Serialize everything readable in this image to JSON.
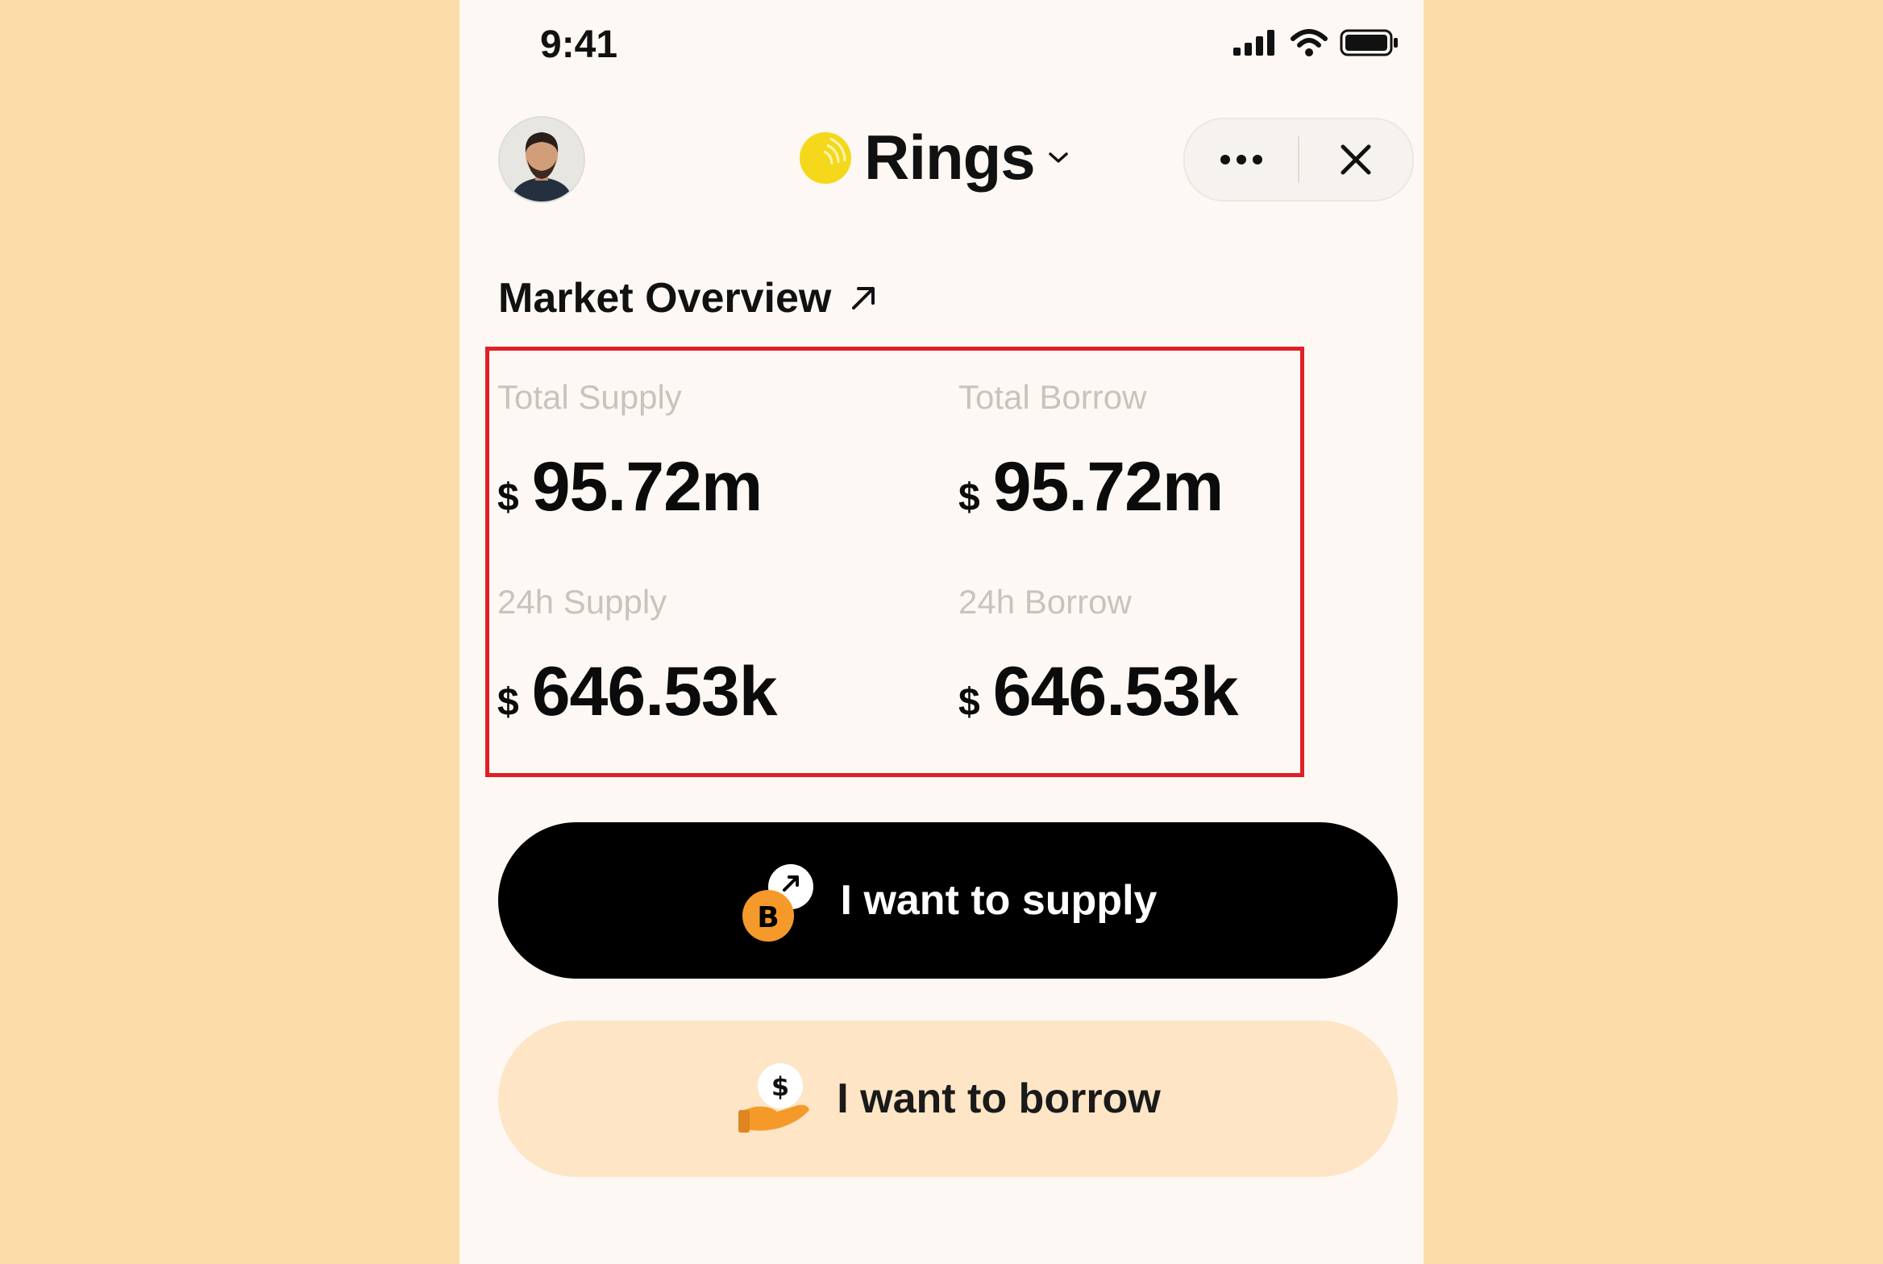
{
  "status_bar": {
    "time": "9:41"
  },
  "header": {
    "brand_name": "Rings",
    "brand_color": "#f5d81b"
  },
  "overview": {
    "title": "Market Overview",
    "stats": [
      {
        "label": "Total Supply",
        "currency": "$",
        "value": "95.72m"
      },
      {
        "label": "Total Borrow",
        "currency": "$",
        "value": "95.72m"
      },
      {
        "label": "24h Supply",
        "currency": "$",
        "value": "646.53k"
      },
      {
        "label": "24h Borrow",
        "currency": "$",
        "value": "646.53k"
      }
    ]
  },
  "actions": {
    "supply_label": "I want to supply",
    "borrow_label": "I want to borrow"
  },
  "colors": {
    "background": "#fcdca9",
    "highlight": "#e01f26",
    "accent_orange": "#f59a2a"
  }
}
